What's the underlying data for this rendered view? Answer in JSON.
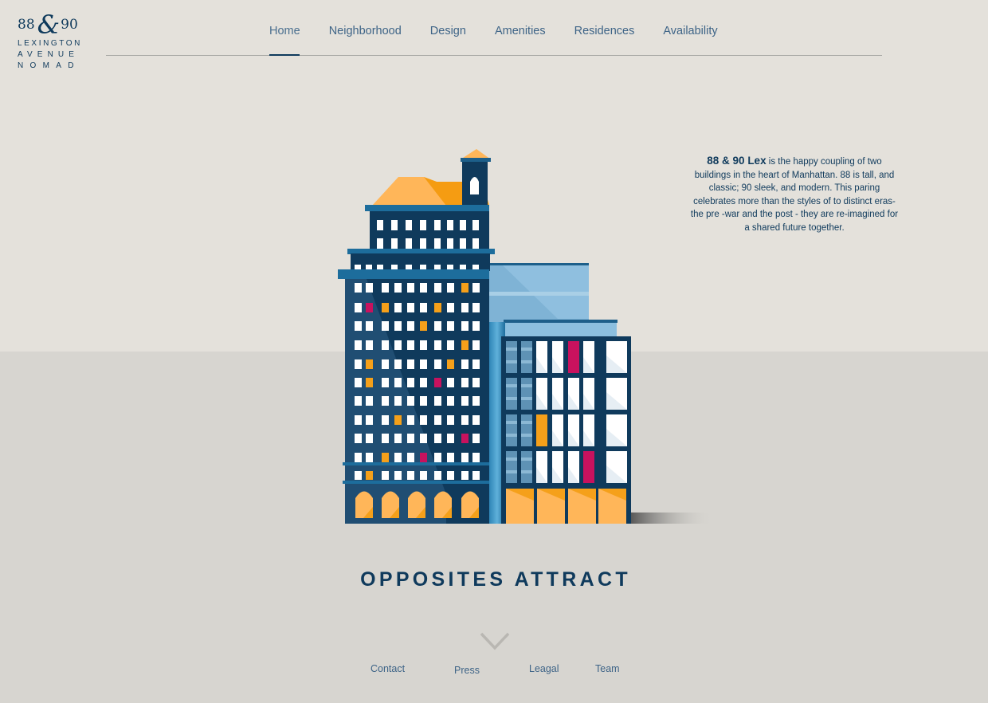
{
  "logo": {
    "num_left": "88",
    "amp": "&",
    "num_right": "90",
    "line1": "LEXINGTON",
    "line2": "AVENUE",
    "line3": "NOMAD"
  },
  "nav": {
    "items": [
      {
        "label": "Home",
        "active": true
      },
      {
        "label": "Neighborhood"
      },
      {
        "label": "Design"
      },
      {
        "label": "Amenities"
      },
      {
        "label": "Residences"
      },
      {
        "label": "Availability"
      }
    ]
  },
  "intro": {
    "bold": "88 & 90 Lex",
    "text": " is the happy coupling of two buildings in the heart of Manhattan. 88 is tall, and classic; 90 sleek, and modern. This paring celebrates more than the styles of to distinct eras- the pre -war and the post - they are re-imagined for a shared future together."
  },
  "headline": "OPPOSITES ATTRACT",
  "footer": {
    "links": [
      "Contact",
      "Press",
      "Leagal",
      "Team"
    ]
  },
  "colors": {
    "navy": "#0f3a5c",
    "orange": "#f5a01a",
    "magenta": "#c8125e",
    "sky": "#7fb3d5",
    "bg_top": "#e4e1db",
    "bg_bottom": "#d7d5d0"
  }
}
